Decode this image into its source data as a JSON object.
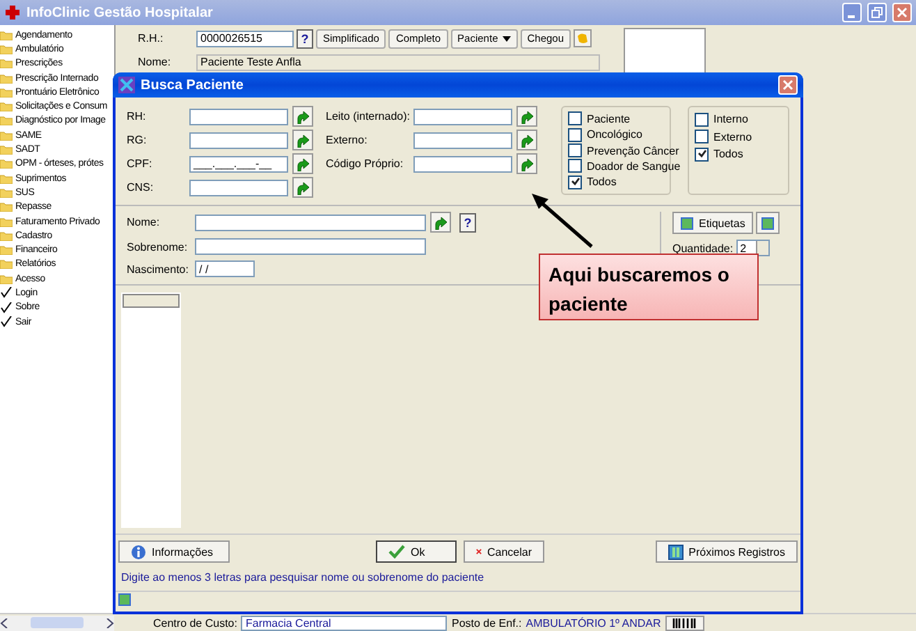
{
  "main_window": {
    "title": "InfoClinic Gestão Hospitalar"
  },
  "sidebar": {
    "items": [
      {
        "label": "Agendamento",
        "kind": "folder"
      },
      {
        "label": "Ambulatório",
        "kind": "folder"
      },
      {
        "label": "Prescrições",
        "kind": "folder"
      },
      {
        "label": "Prescrição Internado",
        "kind": "folder"
      },
      {
        "label": "Prontuário Eletrônico",
        "kind": "folder"
      },
      {
        "label": "Solicitações e Consum",
        "kind": "folder"
      },
      {
        "label": "Diagnóstico por Image",
        "kind": "folder"
      },
      {
        "label": "SAME",
        "kind": "folder"
      },
      {
        "label": "SADT",
        "kind": "folder"
      },
      {
        "label": "OPM - órteses, prótes",
        "kind": "folder"
      },
      {
        "label": "Suprimentos",
        "kind": "folder"
      },
      {
        "label": "SUS",
        "kind": "folder"
      },
      {
        "label": "Repasse",
        "kind": "folder"
      },
      {
        "label": "Faturamento Privado",
        "kind": "folder"
      },
      {
        "label": "Cadastro",
        "kind": "folder"
      },
      {
        "label": "Financeiro",
        "kind": "folder"
      },
      {
        "label": "Relatórios",
        "kind": "folder"
      },
      {
        "label": "Acesso",
        "kind": "folder"
      },
      {
        "label": "Login",
        "kind": "check"
      },
      {
        "label": "Sobre",
        "kind": "check"
      },
      {
        "label": "Sair",
        "kind": "check"
      }
    ]
  },
  "patient_bar": {
    "rh_label": "R.H.:",
    "rh_value": "0000026515",
    "help": "?",
    "buttons": [
      {
        "label": "Simplificado",
        "kind": "plain"
      },
      {
        "label": "Completo",
        "kind": "plain"
      },
      {
        "label": "Paciente",
        "kind": "menu"
      },
      {
        "label": "Chegou",
        "kind": "plain"
      }
    ],
    "name_label": "Nome:",
    "name_value": "Paciente Teste Anfla"
  },
  "status_bar": {
    "cost_center_label": "Centro de Custo:",
    "cost_center_value": "Farmacia Central",
    "post_label": "Posto de Enf.:",
    "post_value": "AMBULATÓRIO 1º ANDAR"
  },
  "dialog": {
    "title": "Busca Paciente",
    "id_fields": [
      {
        "label": "RH:"
      },
      {
        "label": "RG:"
      },
      {
        "label": "CPF:",
        "value": "___.___.___-__"
      },
      {
        "label": "CNS:"
      }
    ],
    "other_fields": [
      {
        "label": "Leito (internado):"
      },
      {
        "label": "Externo:"
      },
      {
        "label": "Código Próprio:"
      }
    ],
    "type_filters": [
      {
        "label": "Paciente",
        "checked": false
      },
      {
        "label": "Oncológico",
        "checked": false
      },
      {
        "label": "Prevenção Câncer",
        "checked": false
      },
      {
        "label": "Doador de Sangue",
        "checked": false
      },
      {
        "label": "Todos",
        "checked": true
      }
    ],
    "origin_filters": [
      {
        "label": "Interno",
        "checked": false
      },
      {
        "label": "Externo",
        "checked": false
      },
      {
        "label": "Todos",
        "checked": true
      }
    ],
    "name_fields": [
      {
        "label": "Nome:"
      },
      {
        "label": "Sobrenome:"
      }
    ],
    "birth": {
      "label": "Nascimento:",
      "value": "/ /"
    },
    "help": "?",
    "labels_button": "Etiquetas",
    "quantity": {
      "label": "Quantidade:",
      "value": "2"
    },
    "buttons": [
      {
        "label": "Informações",
        "kind": "info"
      },
      {
        "label": "Ok",
        "kind": "ok"
      },
      {
        "label": "Cancelar",
        "kind": "cancel"
      },
      {
        "label": "Próximos Registros",
        "kind": "next"
      }
    ],
    "hint": "Digite ao menos 3 letras para pesquisar nome ou sobrenome do paciente"
  },
  "callout": {
    "text": "Aqui buscaremos o paciente"
  }
}
